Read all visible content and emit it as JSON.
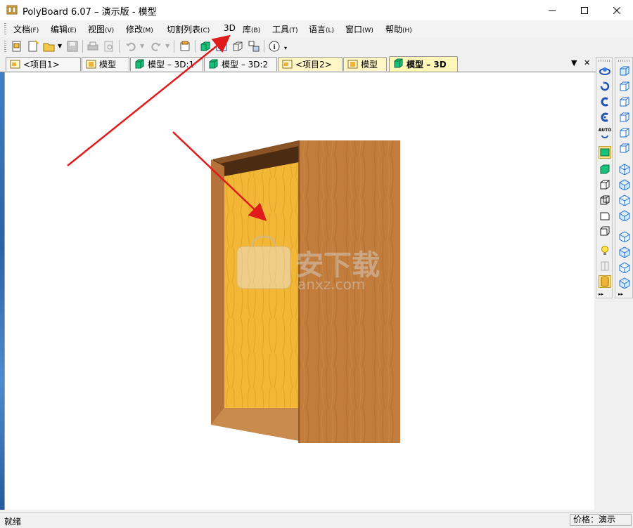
{
  "window": {
    "title": "PolyBoard 6.07 – 演示版 - 模型",
    "controls": [
      "minimize",
      "maximize",
      "close"
    ]
  },
  "menu": {
    "items": [
      {
        "label": "文档",
        "accel": "(F)"
      },
      {
        "label": "编辑",
        "accel": "(E)"
      },
      {
        "label": "视图",
        "accel": "(V)"
      },
      {
        "label": "修改",
        "accel": "(M)"
      },
      {
        "label": "切割列表",
        "accel": "(C)"
      },
      {
        "label": "3D",
        "accel": ""
      },
      {
        "label": "库",
        "accel": "(B)"
      },
      {
        "label": "工具",
        "accel": "(T)"
      },
      {
        "label": "语言",
        "accel": "(L)"
      },
      {
        "label": "窗口",
        "accel": "(W)"
      },
      {
        "label": "帮助",
        "accel": "(H)"
      }
    ]
  },
  "toolbar": {
    "icons": [
      "new-project-icon",
      "new-model-icon",
      "open-folder-icon",
      "save-icon",
      "print-icon",
      "print-preview-icon",
      "undo-icon",
      "redo-icon",
      "properties-icon",
      "view-3d-icon",
      "view-2d-icon",
      "wireframe-icon",
      "parts-icon",
      "info-icon"
    ]
  },
  "tabs": [
    {
      "label": "<项目1>",
      "icon": "project-icon",
      "active": false
    },
    {
      "label": "模型",
      "icon": "model-icon",
      "active": false
    },
    {
      "label": "模型 – 3D:1",
      "icon": "cube-icon",
      "active": false
    },
    {
      "label": "模型 – 3D:2",
      "icon": "cube-icon",
      "active": false
    },
    {
      "label": "<项目2>",
      "icon": "project-icon",
      "active": false
    },
    {
      "label": "模型",
      "icon": "model-icon",
      "active": false
    },
    {
      "label": "模型 – 3D",
      "icon": "cube-icon",
      "active": true
    }
  ],
  "tab_controls": {
    "dropdown": "▼",
    "close": "✕"
  },
  "watermark": {
    "cn": "安下载",
    "en": "anxz.com"
  },
  "side_toolbar_a": {
    "icons": [
      "orbit-icon",
      "rotate-icon",
      "rotate-left-icon",
      "rotate-right-icon",
      "auto-rotate-icon",
      "solid-green-icon",
      "solid-cube-icon",
      "box-view-icon",
      "wire-box-icon",
      "box-outline-icon",
      "box-corner-icon",
      "light-icon",
      "transparent-icon",
      "texture-icon"
    ],
    "auto_label": "AUTO",
    "selected": [
      5,
      13
    ]
  },
  "side_toolbar_b": {
    "icons": [
      "view-front-icon",
      "view-back-icon",
      "view-left-icon",
      "view-right-icon",
      "view-top-icon",
      "view-bottom-icon",
      "iso-1-icon",
      "iso-2-icon",
      "iso-3-icon",
      "iso-4-icon",
      "iso-5-icon",
      "iso-6-icon",
      "iso-7-icon",
      "iso-8-icon"
    ]
  },
  "status": {
    "left": "就绪",
    "right": "价格：演示"
  },
  "colors": {
    "annotation_arrow": "#e01b1b",
    "wood_exterior": "#c17c3c",
    "wood_interior": "#f0b33a",
    "active_tab": "#fff7b8"
  }
}
